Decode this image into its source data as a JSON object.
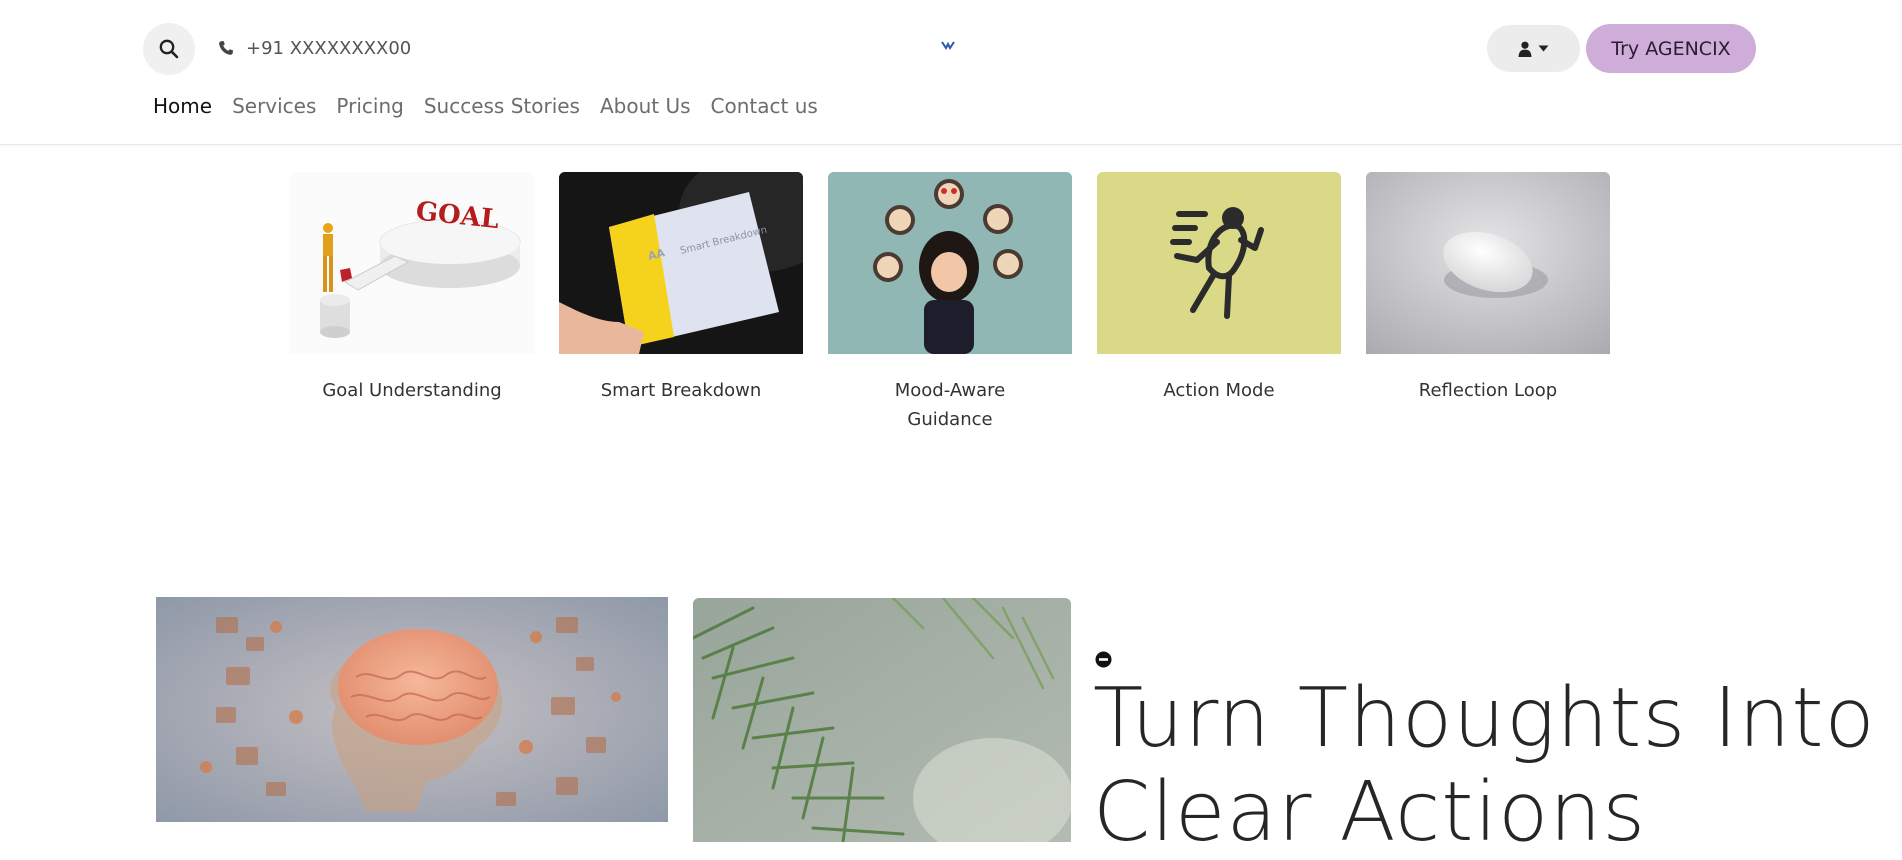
{
  "header": {
    "phone": "+91 XXXXXXXX00",
    "cta_label": "Try AGENCIX",
    "icons": {
      "search": "search-icon",
      "phone": "phone-icon",
      "user": "user-icon",
      "caret": "caret-down-icon",
      "logo": "logo-icon"
    }
  },
  "nav": {
    "items": [
      {
        "label": "Home",
        "active": true
      },
      {
        "label": "Services"
      },
      {
        "label": "Pricing"
      },
      {
        "label": "Success Stories"
      },
      {
        "label": "About Us"
      },
      {
        "label": "Contact us"
      }
    ]
  },
  "features": [
    {
      "label": "Goal Understanding",
      "image": "goal-puzzle-image",
      "image_text": "GOAL"
    },
    {
      "label": "Smart Breakdown",
      "image": "smart-breakdown-book-image",
      "image_text": "Smart Breakdown"
    },
    {
      "label": "Mood-Aware Guidance",
      "image": "girl-with-emotion-faces-image"
    },
    {
      "label": "Action Mode",
      "image": "running-figure-image"
    },
    {
      "label": "Reflection Loop",
      "image": "white-disc-image"
    }
  ],
  "hero": {
    "title": "Turn Thoughts Into Clear Actions",
    "images": [
      "brain-illustration-image",
      "pine-branch-image"
    ]
  },
  "colors": {
    "cta_bg": "#cfadd9",
    "action_mode_bg": "#d9d988",
    "text": "#262626"
  }
}
